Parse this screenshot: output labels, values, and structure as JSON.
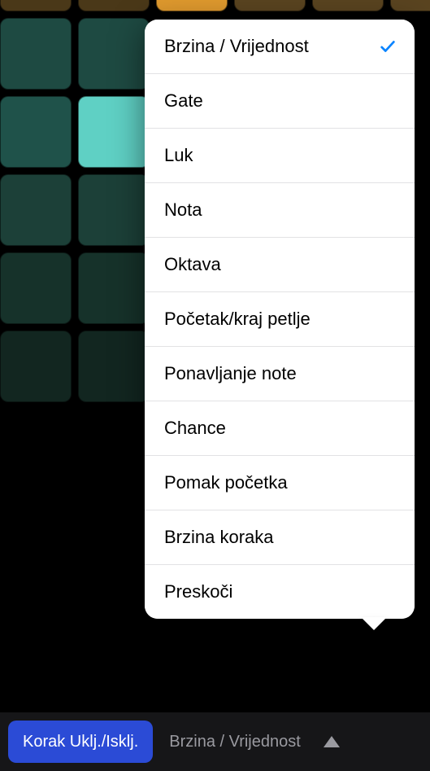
{
  "menu": {
    "items": [
      {
        "label": "Brzina / Vrijednost",
        "selected": true
      },
      {
        "label": "Gate",
        "selected": false
      },
      {
        "label": "Luk",
        "selected": false
      },
      {
        "label": "Nota",
        "selected": false
      },
      {
        "label": "Oktava",
        "selected": false
      },
      {
        "label": "Početak/kraj petlje",
        "selected": false
      },
      {
        "label": "Ponavljanje note",
        "selected": false
      },
      {
        "label": "Chance",
        "selected": false
      },
      {
        "label": "Pomak početka",
        "selected": false
      },
      {
        "label": "Brzina koraka",
        "selected": false
      },
      {
        "label": "Preskoči",
        "selected": false
      }
    ]
  },
  "toolbar": {
    "mode_button": "Korak Uklj./Isklj.",
    "current_mode": "Brzina / Vrijednost"
  }
}
